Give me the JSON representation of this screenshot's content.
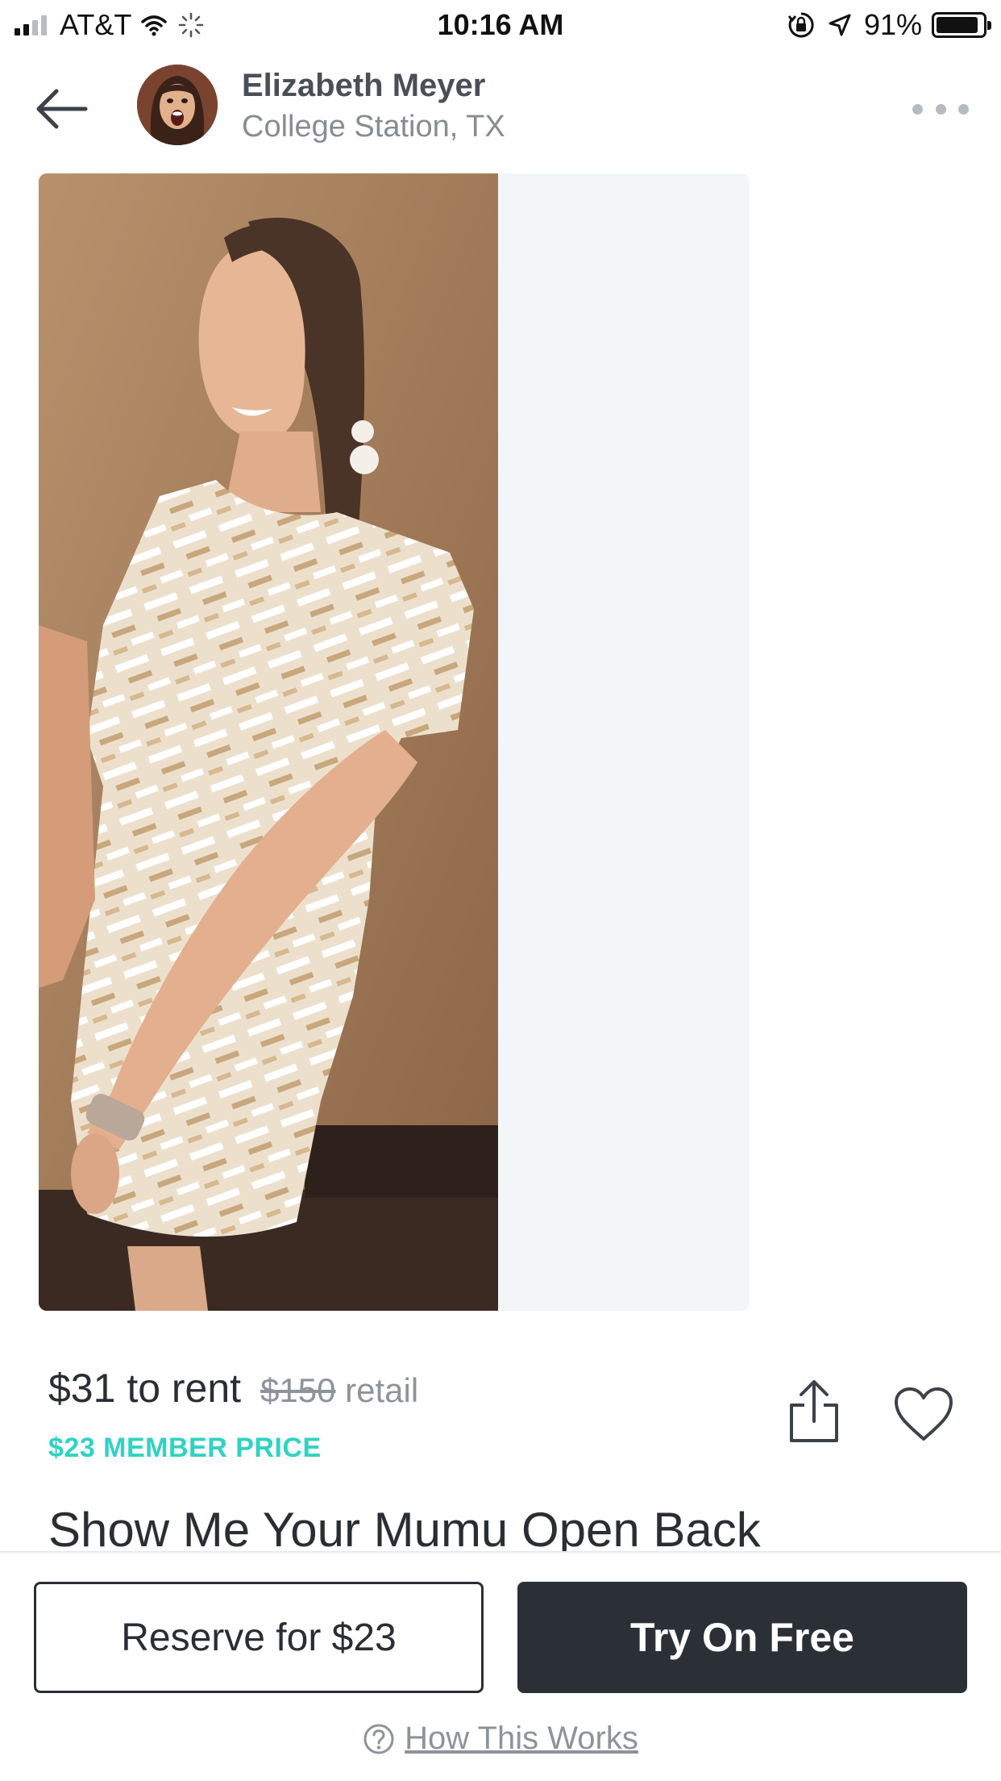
{
  "status_bar": {
    "carrier": "AT&T",
    "time": "10:16 AM",
    "battery": "91%",
    "battery_level": 0.91,
    "icons": [
      "signal-icon",
      "wifi-icon",
      "activity-spinner-icon",
      "orientation-lock-icon",
      "location-arrow-icon",
      "battery-icon"
    ]
  },
  "header": {
    "owner_name": "Elizabeth Meyer",
    "owner_location": "College Station, TX",
    "icons": [
      "back-arrow-icon",
      "more-dots-icon"
    ]
  },
  "listing": {
    "rent_price": "$31 to rent",
    "retail_price": "$150",
    "retail_label": "retail",
    "member_price": "$23 MEMBER PRICE",
    "title": "Show Me Your Mumu Open Back",
    "icons": [
      "share-icon",
      "heart-icon"
    ]
  },
  "actions": {
    "reserve_label": "Reserve for $23",
    "try_label": "Try On Free",
    "how_label": "How This Works",
    "icons": [
      "help-circle-icon"
    ]
  },
  "colors": {
    "accent_teal": "#2fd3c3",
    "dark_button": "#2b2f36",
    "text_dark": "#2a2e34",
    "text_muted": "#8e939a"
  }
}
